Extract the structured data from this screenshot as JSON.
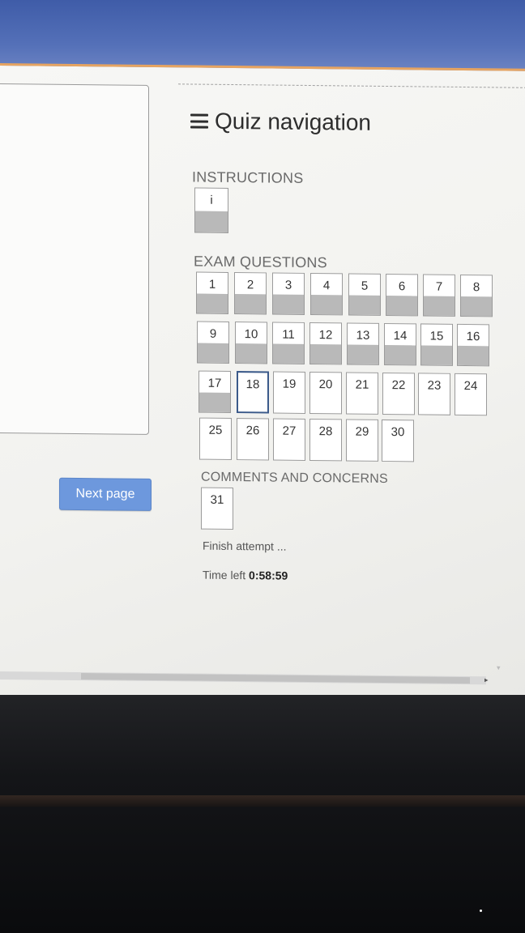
{
  "quiz_navigation": {
    "title": "Quiz navigation",
    "instructions_label": "INSTRUCTIONS",
    "instructions_item": "i",
    "exam_label": "EXAM QUESTIONS",
    "questions": [
      "1",
      "2",
      "3",
      "4",
      "5",
      "6",
      "7",
      "8",
      "9",
      "10",
      "11",
      "12",
      "13",
      "14",
      "15",
      "16",
      "17",
      "18",
      "19",
      "20",
      "21",
      "22",
      "23",
      "24",
      "25",
      "26",
      "27",
      "28",
      "29",
      "30"
    ],
    "answered": [
      "1",
      "2",
      "3",
      "4",
      "5",
      "6",
      "7",
      "8",
      "9",
      "10",
      "11",
      "12",
      "13",
      "14",
      "15",
      "16",
      "17"
    ],
    "current": "18",
    "comments_label": "COMMENTS AND CONCERNS",
    "comments_item": "31",
    "finish_label": "Finish attempt ...",
    "time_left_label": "Time left",
    "time_left_value": "0:58:59"
  },
  "page_nav": {
    "next_label": "Next page"
  },
  "colors": {
    "accent": "#6d98dd",
    "answered_fill": "#b9b9b9",
    "current_border": "#3b5a8a",
    "top_bezel": "#4a66b2"
  }
}
